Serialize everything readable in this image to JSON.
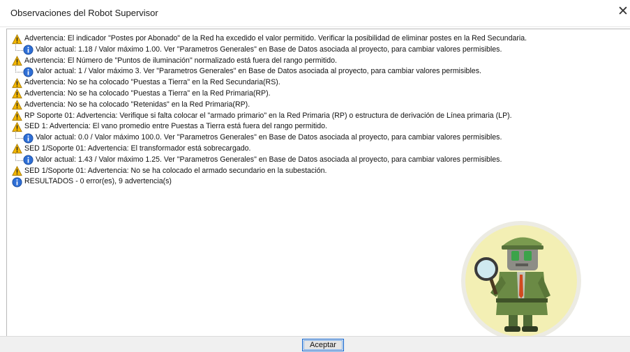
{
  "window": {
    "title": "Observaciones del Robot Supervisor",
    "close_label": "✕"
  },
  "messages": [
    {
      "type": "warning",
      "text": "Advertencia: El indicador \"Postes por Abonado\" de la Red ha excedido el valor permitido. Verificar la posibilidad de eliminar postes en la Red Secundaria."
    },
    {
      "type": "info",
      "text": "Valor actual: 1.18 / Valor máximo 1.00. Ver \"Parametros Generales\" en Base de Datos asociada al proyecto, para cambiar valores permisibles."
    },
    {
      "type": "warning",
      "text": "Advertencia: El Número de \"Puntos de iluminación\" normalizado está fuera del rango permitido."
    },
    {
      "type": "info",
      "text": "Valor actual: 1 / Valor máximo 3. Ver \"Parametros Generales\" en Base de Datos asociada al proyecto, para cambiar valores permisibles."
    },
    {
      "type": "warning",
      "text": "Advertencia: No se ha colocado \"Puestas a Tierra\" en la Red Secundaria(RS)."
    },
    {
      "type": "warning",
      "text": "Advertencia: No se ha colocado \"Puestas a Tierra\" en la Red Primaria(RP)."
    },
    {
      "type": "warning",
      "text": "Advertencia: No se ha colocado \"Retenidas\" en la Red Primaria(RP)."
    },
    {
      "type": "warning",
      "text": "RP Soporte 01: Advertencia: Verifique si falta colocar el \"armado primario\" en la Red Primaria (RP) o estructura de derivación de Línea primaria (LP)."
    },
    {
      "type": "warning",
      "text": "SED 1: Advertencia: El vano promedio entre Puestas a Tierra está fuera del rango permitido."
    },
    {
      "type": "info",
      "text": "Valor actual: 0.0 / Valor máximo 100.0. Ver \"Parametros Generales\" en Base de Datos asociada al proyecto, para cambiar valores permisibles."
    },
    {
      "type": "warning",
      "text": "SED 1/Soporte 01: Advertencia: El transformador está sobrecargado."
    },
    {
      "type": "info",
      "text": "Valor actual: 1.43 / Valor máximo 1.25. Ver \"Parametros Generales\" en Base de Datos asociada al proyecto, para cambiar valores permisibles."
    },
    {
      "type": "warning",
      "text": "SED 1/Soporte 01: Advertencia: No se ha colocado el armado secundario en la subestación."
    },
    {
      "type": "result",
      "text": "RESULTADOS - 0 error(es), 9 advertencia(s)"
    }
  ],
  "icons": {
    "warning": "warning-icon",
    "info": "info-icon",
    "robot": "robot-inspector-icon"
  },
  "colors": {
    "warning_fill": "#f5b800",
    "info_fill": "#2f6fd6",
    "button_border": "#0a64d6",
    "robot_circle": "#f3efb4"
  },
  "footer": {
    "ok_label": "Aceptar"
  }
}
